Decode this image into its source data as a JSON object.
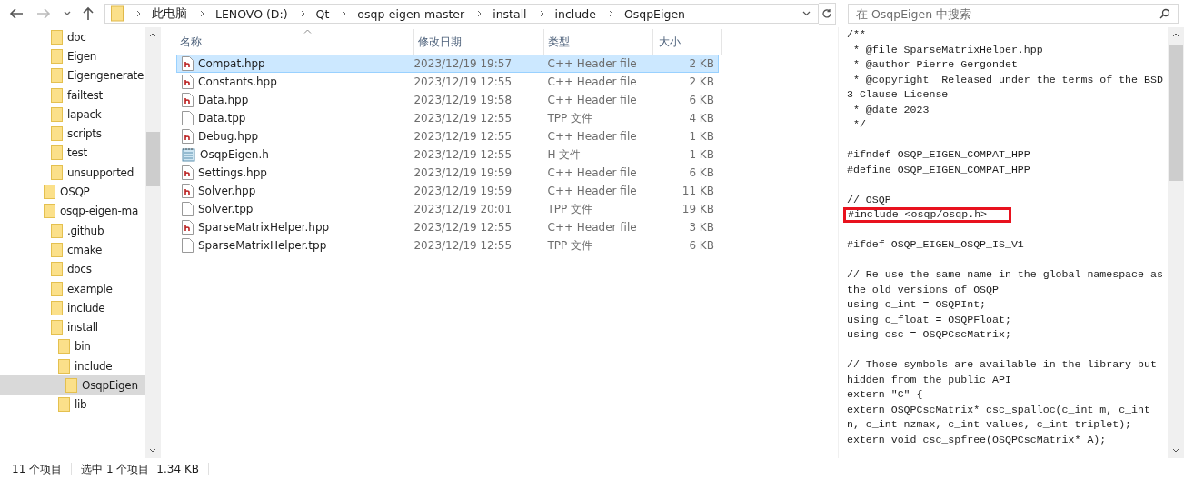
{
  "address": {
    "crumbs": [
      "此电脑",
      "LENOVO (D:)",
      "Qt",
      "osqp-eigen-master",
      "install",
      "include",
      "OsqpEigen"
    ]
  },
  "search": {
    "placeholder": "在 OsqpEigen 中搜索"
  },
  "tree": [
    {
      "children": [
        {
          "label": "doc",
          "selected": false
        },
        {
          "label": "Eigen",
          "selected": false
        },
        {
          "label": "Eigengenerate",
          "selected": false
        },
        {
          "label": "failtest",
          "selected": false
        },
        {
          "label": "lapack",
          "selected": false
        },
        {
          "label": "scripts",
          "selected": false
        },
        {
          "label": "test",
          "selected": false
        },
        {
          "label": "unsupported",
          "selected": false
        }
      ]
    },
    {
      "label": "OSQP",
      "selected": false
    },
    {
      "label": "osqp-eigen-ma",
      "selected": false,
      "children": [
        {
          "label": ".github",
          "selected": false
        },
        {
          "label": "cmake",
          "selected": false
        },
        {
          "label": "docs",
          "selected": false
        },
        {
          "label": "example",
          "selected": false
        },
        {
          "label": "include",
          "selected": false
        },
        {
          "label": "install",
          "selected": false,
          "children": [
            {
              "label": "bin",
              "selected": false
            },
            {
              "label": "include",
              "selected": false,
              "children": [
                {
                  "label": "OsqpEigen",
                  "selected": true
                }
              ]
            },
            {
              "label": "lib",
              "selected": false
            }
          ]
        }
      ]
    }
  ],
  "columns": [
    "名称",
    "修改日期",
    "类型",
    "大小"
  ],
  "files": [
    {
      "name": "Compat.hpp",
      "date": "2023/12/19 19:57",
      "type": "C++ Header file",
      "size": "2 KB",
      "kind": "header",
      "selected": true
    },
    {
      "name": "Constants.hpp",
      "date": "2023/12/19 12:55",
      "type": "C++ Header file",
      "size": "2 KB",
      "kind": "header",
      "selected": false
    },
    {
      "name": "Data.hpp",
      "date": "2023/12/19 19:58",
      "type": "C++ Header file",
      "size": "6 KB",
      "kind": "header",
      "selected": false
    },
    {
      "name": "Data.tpp",
      "date": "2023/12/19 12:55",
      "type": "TPP 文件",
      "size": "4 KB",
      "kind": "blank",
      "selected": false
    },
    {
      "name": "Debug.hpp",
      "date": "2023/12/19 12:55",
      "type": "C++ Header file",
      "size": "1 KB",
      "kind": "header",
      "selected": false
    },
    {
      "name": "OsqpEigen.h",
      "date": "2023/12/19 12:55",
      "type": "H 文件",
      "size": "1 KB",
      "kind": "notepad",
      "selected": false
    },
    {
      "name": "Settings.hpp",
      "date": "2023/12/19 19:59",
      "type": "C++ Header file",
      "size": "6 KB",
      "kind": "header",
      "selected": false
    },
    {
      "name": "Solver.hpp",
      "date": "2023/12/19 19:59",
      "type": "C++ Header file",
      "size": "11 KB",
      "kind": "header",
      "selected": false
    },
    {
      "name": "Solver.tpp",
      "date": "2023/12/19 20:01",
      "type": "TPP 文件",
      "size": "19 KB",
      "kind": "blank",
      "selected": false
    },
    {
      "name": "SparseMatrixHelper.hpp",
      "date": "2023/12/19 12:55",
      "type": "C++ Header file",
      "size": "3 KB",
      "kind": "header",
      "selected": false
    },
    {
      "name": "SparseMatrixHelper.tpp",
      "date": "2023/12/19 12:55",
      "type": "TPP 文件",
      "size": "6 KB",
      "kind": "blank",
      "selected": false
    }
  ],
  "preview": {
    "blocks": [
      {
        "lines": [
          {
            "text": "/**",
            "highlighted": false
          },
          {
            "text": " * @file SparseMatrixHelper.hpp",
            "highlighted": false
          },
          {
            "text": " * @author Pierre Gergondet",
            "highlighted": false
          },
          {
            "text": " * @copyright  Released under the terms of the BSD",
            "highlighted": false
          },
          {
            "text": "3-Clause License",
            "highlighted": false
          },
          {
            "text": " * @date 2023",
            "highlighted": false
          },
          {
            "text": " */",
            "highlighted": false
          }
        ]
      },
      {
        "lines": [
          {
            "text": "#ifndef OSQP_EIGEN_COMPAT_HPP",
            "highlighted": false
          },
          {
            "text": "#define OSQP_EIGEN_COMPAT_HPP",
            "highlighted": false
          }
        ]
      },
      {
        "lines": [
          {
            "text": "// OSQP",
            "highlighted": false
          },
          {
            "text": "#include <osqp/osqp.h>",
            "highlighted": true
          }
        ]
      },
      {
        "lines": [
          {
            "text": "#ifdef OSQP_EIGEN_OSQP_IS_V1",
            "highlighted": false
          }
        ]
      },
      {
        "lines": [
          {
            "text": "// Re-use the same name in the global namespace as",
            "highlighted": false
          },
          {
            "text": "the old versions of OSQP",
            "highlighted": false
          },
          {
            "text": "using c_int = OSQPInt;",
            "highlighted": false
          },
          {
            "text": "using c_float = OSQPFloat;",
            "highlighted": false
          },
          {
            "text": "using csc = OSQPCscMatrix;",
            "highlighted": false
          }
        ]
      },
      {
        "lines": [
          {
            "text": "// Those symbols are available in the library but",
            "highlighted": false
          },
          {
            "text": "hidden from the public API",
            "highlighted": false
          },
          {
            "text": "extern \"C\" {",
            "highlighted": false
          },
          {
            "text": "extern OSQPCscMatrix* csc_spalloc(c_int m, c_int",
            "highlighted": false
          },
          {
            "text": "n, c_int nzmax, c_int values, c_int triplet);",
            "highlighted": false
          },
          {
            "text": "extern void csc_spfree(OSQPCscMatrix* A);",
            "highlighted": false
          }
        ]
      }
    ]
  },
  "status": {
    "count": "11 个项目",
    "selection": "选中 1 个项目",
    "size": "1.34 KB"
  }
}
